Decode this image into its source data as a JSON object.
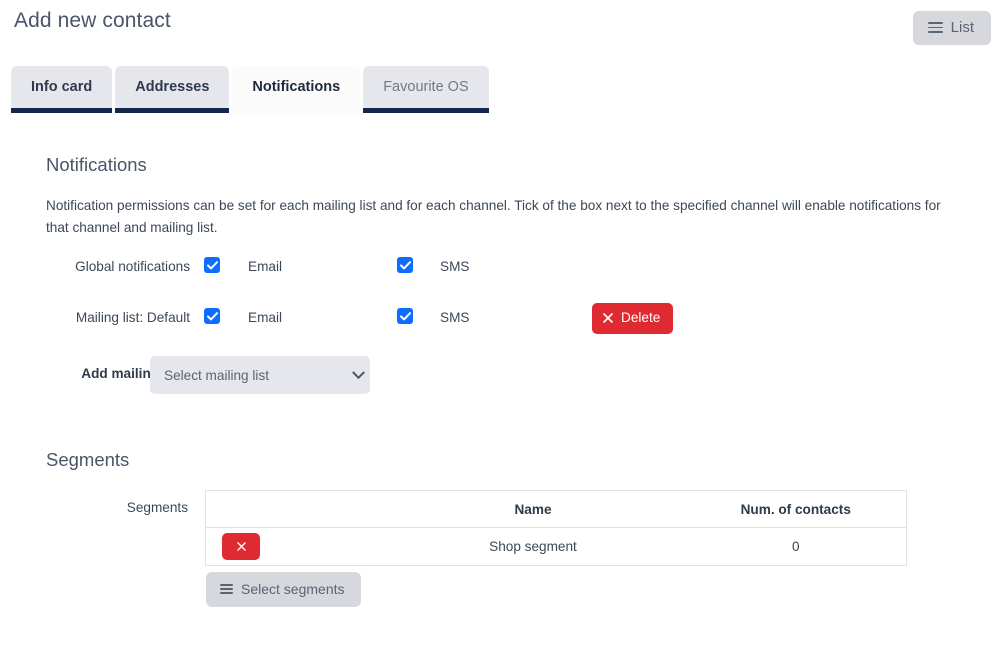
{
  "header": {
    "title": "Add new contact",
    "list_button": {
      "label": "List",
      "icon": "hamburger-icon"
    }
  },
  "tabs": [
    {
      "label": "Info card",
      "active": false,
      "dim": false
    },
    {
      "label": "Addresses",
      "active": false,
      "dim": false
    },
    {
      "label": "Notifications",
      "active": true,
      "dim": false
    },
    {
      "label": "Favourite OS",
      "active": false,
      "dim": true
    }
  ],
  "notifications_section": {
    "heading": "Notifications",
    "description": "Notification permissions can be set for each mailing list and for each channel. Tick of the box next to the specified channel will enable notifications for that channel and mailing list.",
    "rows": [
      {
        "label": "Global notifications",
        "email_label": "Email",
        "email_checked": true,
        "sms_label": "SMS",
        "sms_checked": true,
        "has_delete": false
      },
      {
        "label": "Mailing list: Default",
        "email_label": "Email",
        "email_checked": true,
        "sms_label": "SMS",
        "sms_checked": true,
        "has_delete": true,
        "delete_label": "Delete",
        "delete_icon": "close-x-icon"
      }
    ],
    "add_mailing_list": {
      "label": "Add mailing list:",
      "selected_option": "Select mailing list",
      "options": [
        "Select mailing list"
      ],
      "chevron_icon": "chevron-down-icon"
    }
  },
  "segments_section": {
    "heading": "Segments",
    "row_label": "Segments",
    "table": {
      "columns": [
        "",
        "Name",
        "Num. of contacts"
      ],
      "rows": [
        {
          "remove_icon": "close-x-icon",
          "name": "Shop segment",
          "num_of_contacts": "0"
        }
      ]
    },
    "select_segments_button": {
      "label": "Select segments",
      "icon": "hamburger-icon"
    }
  },
  "colors": {
    "accent_blue": "#0d6efd",
    "danger_red": "#e02a32",
    "tab_underline_navy": "#15284b",
    "tab_inactive_bg": "#e6e7ec",
    "button_grey": "#d6d8de",
    "text": "#3c4858",
    "page_bg": "#ffffff"
  }
}
